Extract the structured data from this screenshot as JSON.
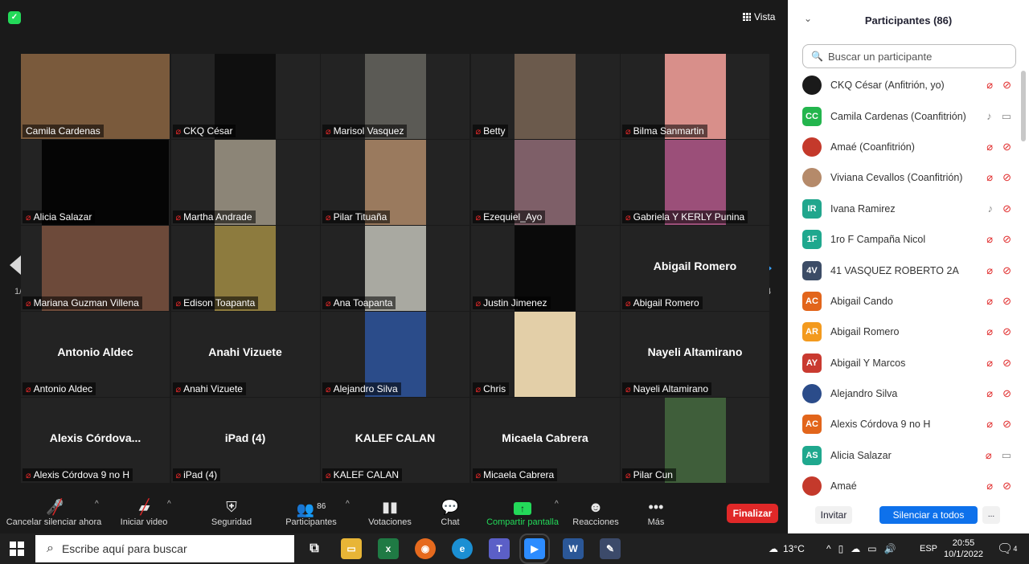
{
  "meeting": {
    "view_label": "Vista",
    "page_indicator_left": "1/4",
    "page_indicator_right": "1/4",
    "tiles": [
      {
        "label": "Camila Cardenas",
        "muted": false,
        "video": "#7a5a3c",
        "active": true,
        "big": ""
      },
      {
        "label": "CKQ César",
        "muted": true,
        "video": "#0f0f0f",
        "big": ""
      },
      {
        "label": "Marisol Vasquez",
        "muted": true,
        "video": "#5b5a55",
        "big": ""
      },
      {
        "label": "Betty",
        "muted": true,
        "video": "#6b5a4c",
        "big": ""
      },
      {
        "label": "Bilma Sanmartin",
        "muted": true,
        "video": "#d88f8a",
        "big": ""
      },
      {
        "label": "Alicia Salazar",
        "muted": true,
        "video": "#050505",
        "big": ""
      },
      {
        "label": "Martha Andrade",
        "muted": true,
        "video": "#8c8577",
        "big": ""
      },
      {
        "label": "Pilar Tituaña",
        "muted": true,
        "video": "#9a7a5e",
        "big": ""
      },
      {
        "label": "Ezequiel_Ayo",
        "muted": true,
        "video": "#7e5f68",
        "big": ""
      },
      {
        "label": "Gabriela Y KERLY Punina",
        "muted": true,
        "video": "#9b4f79",
        "big": ""
      },
      {
        "label": "Mariana Guzman Villena",
        "muted": true,
        "video": "#6d4a3a",
        "big": ""
      },
      {
        "label": "Edison Toapanta",
        "muted": true,
        "video": "#8d7b3e",
        "big": ""
      },
      {
        "label": "Ana Toapanta",
        "muted": true,
        "video": "#a9a9a1",
        "big": ""
      },
      {
        "label": "Justin Jimenez",
        "muted": true,
        "video": "#0a0a0a",
        "big": ""
      },
      {
        "label": "Abigail Romero",
        "muted": true,
        "video": "",
        "big": "Abigail Romero"
      },
      {
        "label": "Antonio Aldec",
        "muted": true,
        "video": "",
        "big": "Antonio Aldec"
      },
      {
        "label": "Anahi Vizuete",
        "muted": true,
        "video": "",
        "big": "Anahi Vizuete"
      },
      {
        "label": "Alejandro Silva",
        "muted": true,
        "video": "#2b4c8a",
        "big": ""
      },
      {
        "label": "Chris",
        "muted": true,
        "video": "#e3cfa8",
        "big": ""
      },
      {
        "label": "Nayeli Altamirano",
        "muted": true,
        "video": "",
        "big": "Nayeli Altamirano"
      },
      {
        "label": "Alexis Córdova 9 no H",
        "muted": true,
        "video": "",
        "big": "Alexis  Córdova..."
      },
      {
        "label": "iPad (4)",
        "muted": true,
        "video": "",
        "big": "iPad (4)"
      },
      {
        "label": "KALEF CALAN",
        "muted": true,
        "video": "",
        "big": "KALEF CALAN"
      },
      {
        "label": "Micaela Cabrera",
        "muted": true,
        "video": "",
        "big": "Micaela Cabrera"
      },
      {
        "label": "Pilar Cun",
        "muted": true,
        "video": "#3f5e3a",
        "big": ""
      }
    ]
  },
  "toolbar": {
    "unmute": "Cancelar silenciar ahora",
    "start_video": "Iniciar video",
    "security": "Seguridad",
    "participants": "Participantes",
    "participants_count": "86",
    "polls": "Votaciones",
    "chat": "Chat",
    "share": "Compartir pantalla",
    "reactions": "Reacciones",
    "more": "Más",
    "end": "Finalizar",
    "share_color": "#23d959"
  },
  "panel": {
    "title": "Participantes (86)",
    "search_placeholder": "Buscar un participante",
    "participants": [
      {
        "name": "CKQ César (Anfitrión, yo)",
        "initials": "",
        "color": "#1a1a1a",
        "mic": "off",
        "cam": "off"
      },
      {
        "name": "Camila Cardenas (Coanfitrión)",
        "initials": "CC",
        "color": "#23b54d",
        "mic": "on",
        "cam": "on"
      },
      {
        "name": "Amaé (Coanfitrión)",
        "initials": "",
        "color": "#c4392b",
        "mic": "off",
        "cam": "off"
      },
      {
        "name": "Viviana Cevallos (Coanfitrión)",
        "initials": "",
        "color": "#b58a6a",
        "mic": "off",
        "cam": "off"
      },
      {
        "name": "Ivana Ramirez",
        "initials": "IR",
        "color": "#21a68d",
        "mic": "on",
        "cam": "off"
      },
      {
        "name": "1ro F Campaña Nicol",
        "initials": "1F",
        "color": "#1fa88e",
        "mic": "off",
        "cam": "off"
      },
      {
        "name": "41 VASQUEZ ROBERTO 2A",
        "initials": "4V",
        "color": "#3c4c66",
        "mic": "off",
        "cam": "off"
      },
      {
        "name": "Abigail Cando",
        "initials": "AC",
        "color": "#e2651b",
        "mic": "off",
        "cam": "off"
      },
      {
        "name": "Abigail Romero",
        "initials": "AR",
        "color": "#f39a1e",
        "mic": "off",
        "cam": "off"
      },
      {
        "name": "Abigail Y Marcos",
        "initials": "AY",
        "color": "#c93a30",
        "mic": "off",
        "cam": "off"
      },
      {
        "name": "Alejandro Silva",
        "initials": "",
        "color": "#2b4c8a",
        "mic": "off",
        "cam": "off"
      },
      {
        "name": "Alexis Córdova 9 no H",
        "initials": "AC",
        "color": "#e2651b",
        "mic": "off",
        "cam": "off"
      },
      {
        "name": "Alicia Salazar",
        "initials": "AS",
        "color": "#1fa88e",
        "mic": "off",
        "cam": "on"
      },
      {
        "name": "Amaé",
        "initials": "",
        "color": "#c4392b",
        "mic": "off",
        "cam": "off"
      }
    ],
    "invite": "Invitar",
    "mute_all": "Silenciar a todos",
    "more": "..."
  },
  "taskbar": {
    "search_placeholder": "Escribe aquí para buscar",
    "temperature": "13°C",
    "language": "ESP",
    "time": "20:55",
    "date": "10/1/2022",
    "notification_count": "4"
  }
}
